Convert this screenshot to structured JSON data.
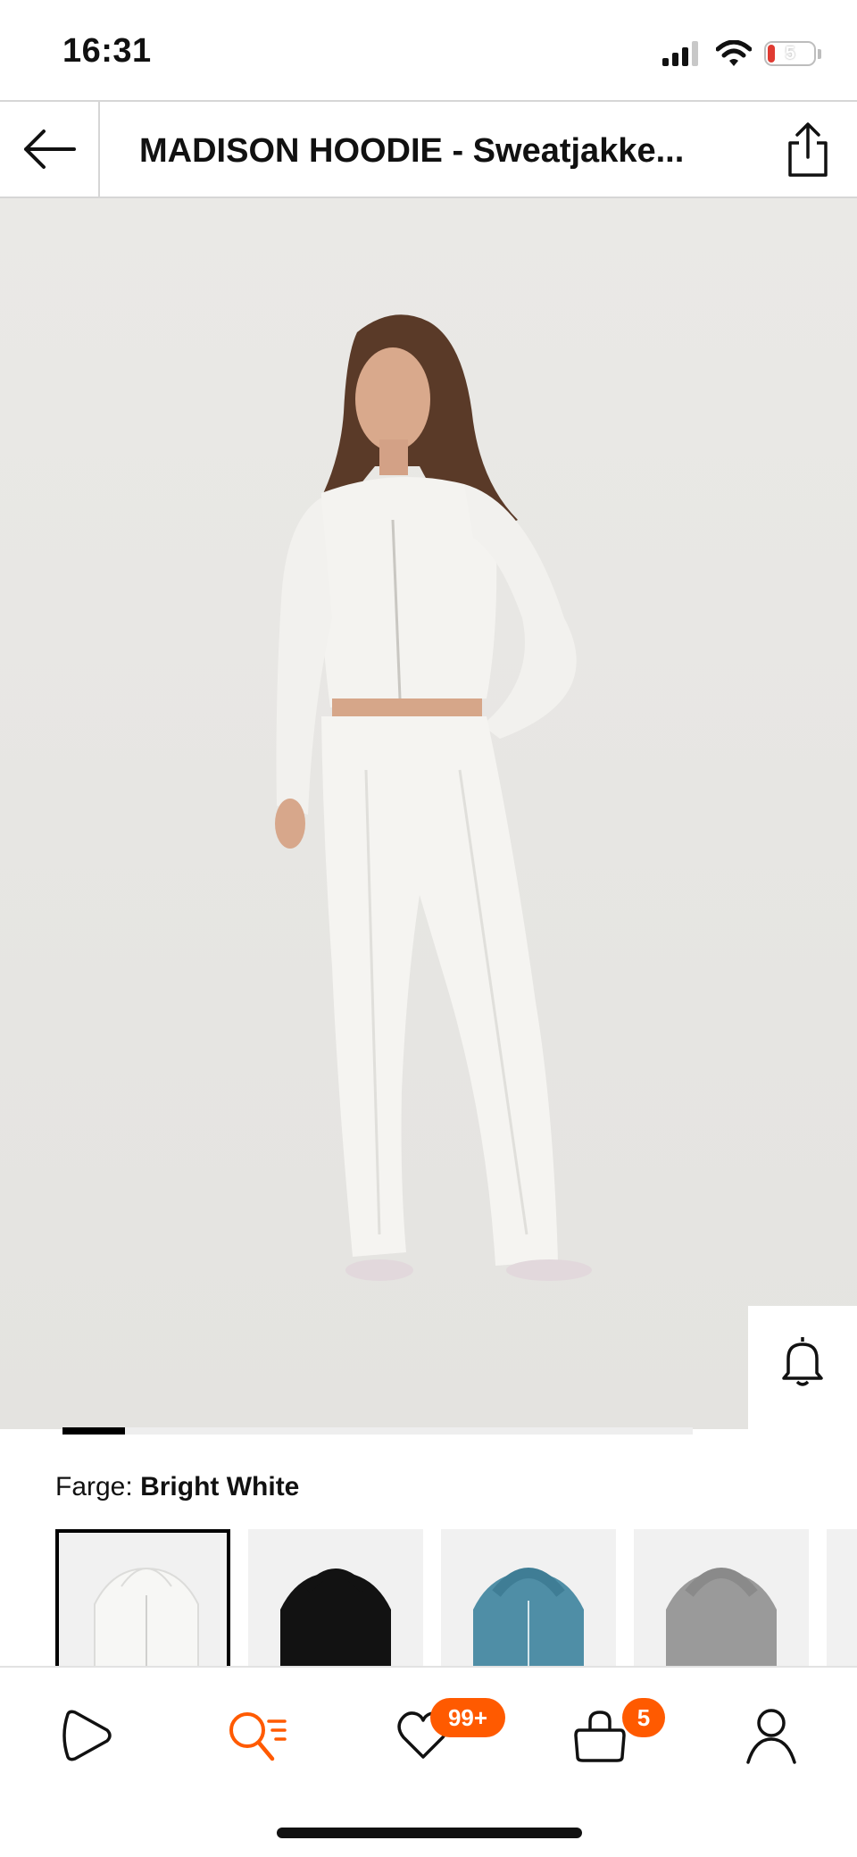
{
  "status_bar": {
    "time": "16:31",
    "battery": "5"
  },
  "header": {
    "title": "MADISON HOODIE - Sweatjakke..."
  },
  "color": {
    "label": "Farge:",
    "value": "Bright White"
  },
  "swatches": [
    {
      "color": "#f4f4f2"
    },
    {
      "color": "#121212"
    },
    {
      "color": "#4f8ea6"
    },
    {
      "color": "#9a9a9a"
    }
  ],
  "nav": {
    "wishlist_badge": "99+",
    "bag_badge": "5"
  },
  "colors": {
    "accent": "#ff5a00",
    "image_bg": "#e9e8e6"
  }
}
